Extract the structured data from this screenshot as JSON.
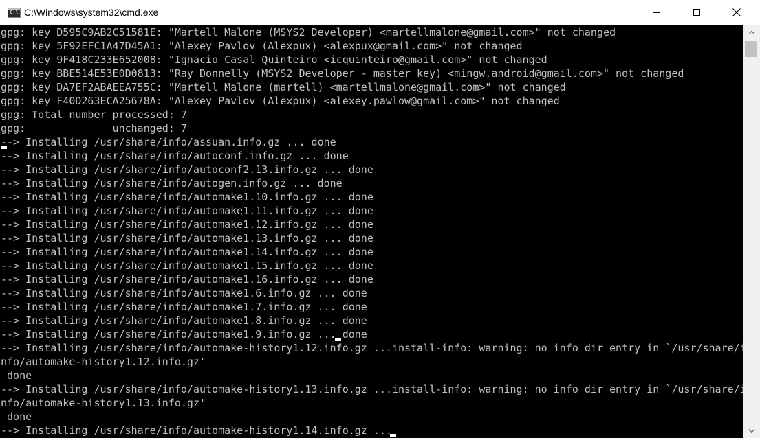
{
  "window": {
    "title": "C:\\Windows\\system32\\cmd.exe",
    "app_icon": "cmd-console-icon",
    "controls": {
      "minimize": "minimize-icon",
      "maximize": "maximize-icon",
      "close": "close-icon"
    }
  },
  "terminal": {
    "lines": [
      "gpg: key D595C9AB2C51581E: \"Martell Malone (MSYS2 Developer) <martellmalone@gmail.com>\" not changed",
      "gpg: key 5F92EFC1A47D45A1: \"Alexey Pavlov (Alexpux) <alexpux@gmail.com>\" not changed",
      "gpg: key 9F418C233E652008: \"Ignacio Casal Quinteiro <icquinteiro@gmail.com>\" not changed",
      "gpg: key BBE514E53E0D0813: \"Ray Donnelly (MSYS2 Developer - master key) <mingw.android@gmail.com>\" not changed",
      "gpg: key DA7EF2ABAEEA755C: \"Martell Malone (martell) <martellmalone@gmail.com>\" not changed",
      "gpg: key F40D263ECA25678A: \"Alexey Pavlov (Alexpux) <alexey.pawlow@gmail.com>\" not changed",
      "gpg: Total number processed: 7",
      "gpg:              unchanged: 7",
      "--> Installing /usr/share/info/assuan.info.gz ... done",
      "--> Installing /usr/share/info/autoconf.info.gz ... done",
      "--> Installing /usr/share/info/autoconf2.13.info.gz ... done",
      "--> Installing /usr/share/info/autogen.info.gz ... done",
      "--> Installing /usr/share/info/automake1.10.info.gz ... done",
      "--> Installing /usr/share/info/automake1.11.info.gz ... done",
      "--> Installing /usr/share/info/automake1.12.info.gz ... done",
      "--> Installing /usr/share/info/automake1.13.info.gz ... done",
      "--> Installing /usr/share/info/automake1.14.info.gz ... done",
      "--> Installing /usr/share/info/automake1.15.info.gz ... done",
      "--> Installing /usr/share/info/automake1.16.info.gz ... done",
      "--> Installing /usr/share/info/automake1.6.info.gz ... done",
      "--> Installing /usr/share/info/automake1.7.info.gz ... done",
      "--> Installing /usr/share/info/automake1.8.info.gz ... done",
      "--> Installing /usr/share/info/automake1.9.info.gz ... done",
      "--> Installing /usr/share/info/automake-history1.12.info.gz ...install-info: warning: no info dir entry in `/usr/share/i",
      "nfo/automake-history1.12.info.gz'",
      " done",
      "--> Installing /usr/share/info/automake-history1.13.info.gz ...install-info: warning: no info dir entry in `/usr/share/i",
      "nfo/automake-history1.13.info.gz'",
      " done",
      "--> Installing /usr/share/info/automake-history1.14.info.gz ..."
    ]
  },
  "scrollbar": {
    "up_icon": "scroll-up-arrow-icon",
    "down_icon": "scroll-down-arrow-icon"
  },
  "colors": {
    "background": "#000000",
    "text": "#c0c0c0",
    "titlebar": "#ffffff",
    "cursor": "#ffffff"
  }
}
